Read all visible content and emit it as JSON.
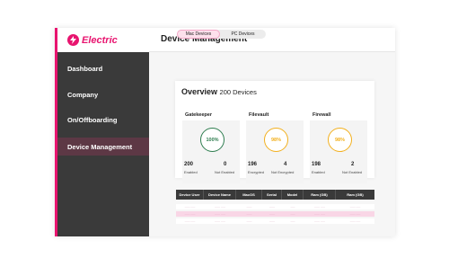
{
  "brand": {
    "name": "Electric",
    "accent": "#e8146f"
  },
  "header": {
    "title": "Device Management"
  },
  "sidebar": {
    "items": [
      {
        "label": "Dashboard"
      },
      {
        "label": "Company"
      },
      {
        "label": "On/Offboarding"
      },
      {
        "label": "Device Management",
        "active": true
      }
    ]
  },
  "tabs": [
    {
      "label": "Mac Devices",
      "active": true
    },
    {
      "label": "PC Devices",
      "active": false
    }
  ],
  "overview": {
    "title": "Overview",
    "count_text": "200 Devices",
    "metrics": [
      {
        "label": "Gatekeeper",
        "percent": "100%",
        "status_color": "#2e7d4f",
        "left_value": "200",
        "left_label": "Enabled",
        "right_value": "0",
        "right_label": "Not Enabled"
      },
      {
        "label": "Filevault",
        "percent": "98%",
        "status_color": "#f2b01e",
        "left_value": "196",
        "left_label": "Encrypted",
        "right_value": "4",
        "right_label": "Not Encrypted"
      },
      {
        "label": "Firewall",
        "percent": "98%",
        "status_color": "#f2b01e",
        "left_value": "198",
        "left_label": "Enabled",
        "right_value": "2",
        "right_label": "Not Enabled"
      }
    ]
  },
  "table": {
    "columns": [
      "Device User",
      "Device Name",
      "MacOS",
      "Serial",
      "Model",
      "Ram (GB)",
      "Ram (GB)"
    ],
    "rows": [
      [
        "------ -----",
        "------ -----",
        "------",
        "------",
        "-----",
        "------ -----",
        "------ -----"
      ],
      [
        "------ -----",
        "------ -----",
        "------",
        "------",
        "-----",
        "------ -----",
        "------ -----"
      ],
      [
        "------ -----",
        "------ -----",
        "------",
        "------",
        "-----",
        "------ -----",
        "------ -----"
      ]
    ]
  }
}
